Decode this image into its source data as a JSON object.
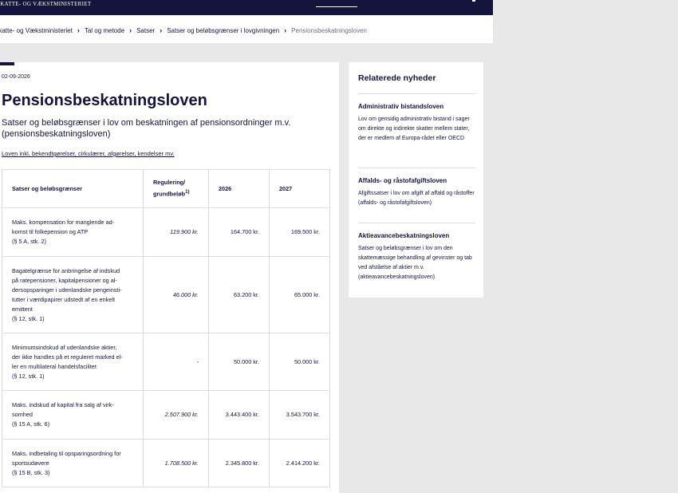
{
  "header": {
    "ministry_name": "SKATTE- OG VÆKSTMINISTERIET"
  },
  "breadcrumb": {
    "items": [
      "Skatte- og Vækstministeriet",
      "Tal og metode",
      "Satser",
      "Satser og beløbsgrænser i lovgivningen",
      "Pensionsbeskatningsloven"
    ]
  },
  "article": {
    "date": "02-09-2026",
    "title": "Pensionsbeskatningsloven",
    "subtitle": "Satser og beløbsgrænser i lov om beskatningen af pensionsordninger m.v. (pensionsbeskatningsloven)",
    "law_link": "Loven inkl. bekendtgørelser, cirkulærer, afgørelser, kendelser mv."
  },
  "table": {
    "headers": {
      "desc": "Satser og beløbsgrænser",
      "reg": "Regulering/ grundbeløb",
      "reg_sup": "1)",
      "y1": "2026",
      "y2": "2027"
    },
    "rows": [
      {
        "desc": "Maks. kompensation for manglende ad-\nkomst til folkepension og ATP\n(§ 5 A, stk. 2)",
        "reg": "119.900 kr.",
        "y1": "164.700 kr.",
        "y2": "169.500 kr."
      },
      {
        "desc": "Bagatelgrænse for anbringelse af indskud\npå ratepensioner, kapitalpensioner og al-\ndersopsparinger i udenlandske pengeinsti-\ntutter i værdipapirer udstedt af en enkelt\nemittent\n(§ 12, stk. 1)",
        "reg": "46.000 kr.",
        "y1": "63.200 kr.",
        "y2": "65.000 kr."
      },
      {
        "desc": "Minimumsindskud af udenlandske aktier,\nder ikke handles på et reguleret marked el-\nler en multilateral handelsfacilitet\n(§ 12, stk. 1)",
        "reg": "-",
        "y1": "50.000 kr.",
        "y2": "50.000 kr."
      },
      {
        "desc": "Maks. indskud af kapital fra salg af virk-\nsomhed\n(§ 15 A, stk. 6)",
        "reg": "2.507.900 kr.",
        "y1": "3.443.400 kr.",
        "y2": "3.543.700 kr."
      },
      {
        "desc": "Maks. indbetaling til opsparingsordning for\nsportsudøvere\n(§ 15 B, stk. 3)",
        "reg": "1.708.500 kr.",
        "y1": "2.345.800 kr.",
        "y2": "2.414.200 kr."
      }
    ]
  },
  "sidebar": {
    "heading": "Relaterede nyheder",
    "items": [
      {
        "title": "Administrativ bistandsloven",
        "desc": "Lov om gensidig administrativ bistand i sager om direkte og indirekte skatter mellem stater, der er medlem af Europa-rådet eller OECD"
      },
      {
        "title": "Affalds- og råstofafgiftsloven",
        "desc": "Afgiftssatser i lov om afgift af affald og råstoffer (affalds- og råstofafgiftsloven)"
      },
      {
        "title": "Aktieavancebeskatningsloven",
        "desc": "Satser og beløbsgrænser i lov om den skattemæssige behandling af gevinster og tab ved afståelse af aktier m.v. (aktieavancebeskatningsloven)"
      }
    ]
  }
}
